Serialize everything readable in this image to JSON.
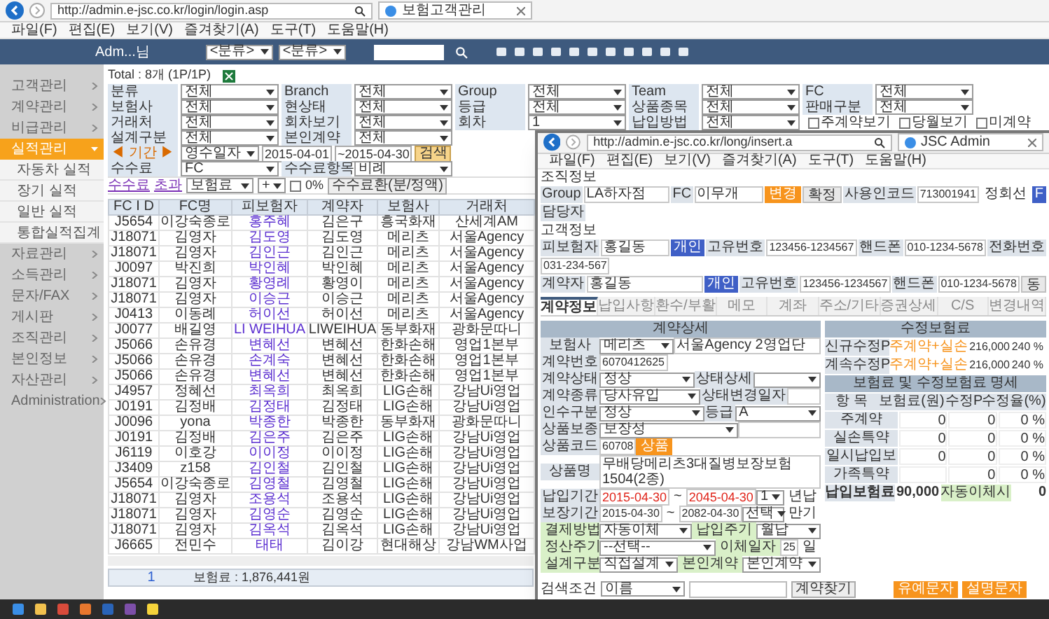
{
  "browser": {
    "url": "http://admin.e-jsc.co.kr/login/login.asp",
    "tab": "보험고객관리",
    "menu": [
      "파일(F)",
      "편집(E)",
      "보기(V)",
      "즐겨찾기(A)",
      "도구(T)",
      "도움말(H)"
    ]
  },
  "app_header": {
    "user": "Adm...님",
    "selects": [
      "<분류>",
      "<분류>"
    ]
  },
  "sidebar": [
    {
      "label": "고객관리",
      "kind": "menu",
      "selected": false
    },
    {
      "label": "계약관리",
      "kind": "menu",
      "selected": false
    },
    {
      "label": "비급관리",
      "kind": "menu",
      "selected": false
    },
    {
      "label": "실적관리",
      "kind": "menu",
      "selected": true
    },
    {
      "label": "자동차 실적",
      "kind": "sub",
      "selected": false
    },
    {
      "label": "장기 실적",
      "kind": "sub",
      "selected": false
    },
    {
      "label": "일반 실적",
      "kind": "sub",
      "selected": false
    },
    {
      "label": "통합실적집계",
      "kind": "sub",
      "selected": false
    },
    {
      "label": "자료관리",
      "kind": "menu",
      "selected": false
    },
    {
      "label": "소득관리",
      "kind": "menu",
      "selected": false
    },
    {
      "label": "문자/FAX",
      "kind": "menu",
      "selected": false
    },
    {
      "label": "게시판",
      "kind": "menu",
      "selected": false
    },
    {
      "label": "조직관리",
      "kind": "menu",
      "selected": false
    },
    {
      "label": "본인정보",
      "kind": "menu",
      "selected": false
    },
    {
      "label": "자산관리",
      "kind": "menu",
      "selected": false
    },
    {
      "label": "Administration",
      "kind": "menu",
      "selected": false
    }
  ],
  "total": "Total : 8개 (1P/1P)",
  "filter_rows": [
    [
      {
        "label": "분류",
        "value": "전체"
      },
      {
        "label": "Branch",
        "value": "전체"
      },
      {
        "label": "Group",
        "value": "전체"
      },
      {
        "label": "Team",
        "value": "전체"
      },
      {
        "label": "FC",
        "value": "전체"
      }
    ],
    [
      {
        "label": "보험사",
        "value": "전체"
      },
      {
        "label": "현상태",
        "value": "전체"
      },
      {
        "label": "등급",
        "value": "전체"
      },
      {
        "label": "상품종목",
        "value": "전체"
      },
      {
        "label": "판매구분",
        "value": "전체"
      }
    ],
    [
      {
        "label": "거래처",
        "value": "전체"
      },
      {
        "label": "회차보기",
        "value": "전체"
      },
      {
        "label": "회차",
        "value": "1"
      },
      {
        "label": "납입방법",
        "value": "전체"
      }
    ]
  ],
  "filter_checks": [
    {
      "label": "주계약보기",
      "checked": false
    },
    {
      "label": "당월보기",
      "checked": false
    },
    {
      "label": "미계약",
      "checked": false
    }
  ],
  "filter_rows_left": [
    [
      {
        "label": "설계구분",
        "value": "전체"
      },
      {
        "label": "본인계약",
        "value": "전체"
      }
    ]
  ],
  "period": {
    "label": "◀ 기간 ▶",
    "select": "영수일자",
    "from": "2015-04-01",
    "to": "~2015-04-30",
    "button": "검색"
  },
  "fee_row": [
    {
      "label": "수수료",
      "value": "FC"
    },
    {
      "label": "수수료항목",
      "value": "비례"
    }
  ],
  "fee_toolbar": {
    "links": [
      "수수료",
      "초과"
    ],
    "select": "보험료",
    "select2": "+",
    "percent": "0%",
    "checked": false,
    "button": "수수료환(분/정액)"
  },
  "table": {
    "columns": [
      "FC I D",
      "FC명",
      "피보험자",
      "계약자",
      "보험사",
      "거래처"
    ],
    "rows": [
      [
        "J5654",
        "이강숙종로",
        "홍주혜",
        "김은구",
        "흥국화재",
        "산세계AM"
      ],
      [
        "J18071",
        "김영자",
        "김도영",
        "김도영",
        "메리츠",
        "서울Agency"
      ],
      [
        "J18071",
        "김영자",
        "김인근",
        "김인근",
        "메리츠",
        "서울Agency"
      ],
      [
        "J0097",
        "박진희",
        "박인혜",
        "박인혜",
        "메리츠",
        "서울Agency"
      ],
      [
        "J18071",
        "김영자",
        "황영례",
        "황영이",
        "메리츠",
        "서울Agency"
      ],
      [
        "J18071",
        "김영자",
        "이승근",
        "이승근",
        "메리츠",
        "서울Agency"
      ],
      [
        "J0413",
        "이동례",
        "허이선",
        "허이선",
        "메리츠",
        "서울Agency"
      ],
      [
        "J0077",
        "배길영",
        "LI WEIHUA",
        "LIWEIHUA",
        "동부화재",
        "광화문따니"
      ],
      [
        "J5066",
        "손유경",
        "변혜선",
        "변혜선",
        "한화손해",
        "영업1본부"
      ],
      [
        "J5066",
        "손유경",
        "손계숙",
        "변혜선",
        "한화손해",
        "영업1본부"
      ],
      [
        "J5066",
        "손유경",
        "변혜선",
        "변혜선",
        "한화손해",
        "영업1본부"
      ],
      [
        "J4957",
        "정혜선",
        "최옥희",
        "최옥희",
        "LIG손해",
        "강남Ui영업"
      ],
      [
        "J0191",
        "김정배",
        "김정태",
        "김정태",
        "LIG손해",
        "강남Ui영업"
      ],
      [
        "J0096",
        "yona",
        "박종한",
        "박종한",
        "동부화재",
        "광화문따니"
      ],
      [
        "J0191",
        "김정배",
        "김은주",
        "김은주",
        "LIG손해",
        "강남Ui영업"
      ],
      [
        "J6119",
        "이호강",
        "이이정",
        "이이정",
        "LIG손해",
        "강남Ui영업"
      ],
      [
        "J3409",
        "z158",
        "김인철",
        "김인철",
        "LIG손해",
        "강남Ui영업"
      ],
      [
        "J5654",
        "이강숙종로",
        "김영철",
        "김영철",
        "LIG손해",
        "강남Ui영업"
      ],
      [
        "J18071",
        "김영자",
        "조용석",
        "조용석",
        "LIG손해",
        "강남Ui영업"
      ],
      [
        "J18071",
        "김영자",
        "김영순",
        "김영순",
        "LIG손해",
        "강남Ui영업"
      ],
      [
        "J18071",
        "김영자",
        "김옥석",
        "김옥석",
        "LIG손해",
        "강남Ui영업"
      ],
      [
        "J6665",
        "전민수",
        "태태",
        "김이강",
        "현대해상",
        "강남WM사업"
      ]
    ]
  },
  "pager": {
    "page": "1",
    "summary": "보험료 : 1,876,441원"
  },
  "popup": {
    "url": "http://admin.e-jsc.co.kr/long/insert.a",
    "tab": "JSC Admin",
    "menu": [
      "파일(F)",
      "편집(E)",
      "보기(V)",
      "즐겨찾기(A)",
      "도구(T)",
      "도움말(H)"
    ],
    "org": {
      "title": "조직정보",
      "items": [
        {
          "kind": "label",
          "text": "Group"
        },
        {
          "kind": "field",
          "text": "LA하자점"
        },
        {
          "kind": "label",
          "text": "FC"
        },
        {
          "kind": "field",
          "text": "이무개"
        },
        {
          "kind": "accent",
          "text": "변경"
        },
        {
          "kind": "button",
          "text": "확정"
        },
        {
          "kind": "label",
          "text": "사용인코드"
        },
        {
          "kind": "number",
          "text": "713001941"
        },
        {
          "kind": "text",
          "text": "정회선"
        },
        {
          "kind": "badge",
          "text": "F"
        },
        {
          "kind": "label",
          "text": "담당자"
        }
      ]
    },
    "customer": {
      "title": "고객정보",
      "rows": [
        {
          "items": [
            {
              "kind": "label",
              "text": "피보험자"
            },
            {
              "kind": "field",
              "text": "홍길동"
            },
            {
              "kind": "badge",
              "text": "개인"
            },
            {
              "kind": "label",
              "text": "고유번호"
            },
            {
              "kind": "number",
              "text": "123456-1234567"
            },
            {
              "kind": "label",
              "text": "핸드폰"
            },
            {
              "kind": "number",
              "text": "010-1234-5678"
            },
            {
              "kind": "label",
              "text": "전화번호"
            },
            {
              "kind": "number",
              "text": "031-234-567"
            }
          ]
        },
        {
          "items": [
            {
              "kind": "label",
              "text": "계약자"
            },
            {
              "kind": "field",
              "text": "홍길동"
            },
            {
              "kind": "badge",
              "text": "개인"
            },
            {
              "kind": "label",
              "text": "고유번호"
            },
            {
              "kind": "number",
              "text": "123456-1234567"
            },
            {
              "kind": "label",
              "text": "핸드폰"
            },
            {
              "kind": "number",
              "text": "010-1234-5678"
            },
            {
              "kind": "button",
              "text": "동"
            }
          ]
        }
      ]
    },
    "tabs": [
      {
        "label": "계약정보",
        "selected": true
      },
      {
        "label": "납입사항",
        "selected": false
      },
      {
        "label": "환수/부활",
        "selected": false
      },
      {
        "label": "메모",
        "selected": false
      },
      {
        "label": "계좌",
        "selected": false
      },
      {
        "label": "주소/기타",
        "selected": false
      },
      {
        "label": "증권상세",
        "selected": false
      },
      {
        "label": "C/S",
        "selected": false
      },
      {
        "label": "변경내역",
        "selected": false
      }
    ],
    "contract": {
      "title": "계약상세",
      "rows": [
        {
          "items": [
            {
              "kind": "label",
              "text": "보험사"
            },
            {
              "kind": "select",
              "text": "메리츠"
            },
            {
              "kind": "field",
              "text": "서울Agency 2영업단"
            }
          ]
        },
        {
          "items": [
            {
              "kind": "label",
              "text": "계약번호"
            },
            {
              "kind": "number",
              "text": "6070412625"
            }
          ]
        },
        {
          "items": [
            {
              "kind": "label",
              "text": "계약상태"
            },
            {
              "kind": "select",
              "text": "정상"
            },
            {
              "kind": "label",
              "text": "상태상세"
            },
            {
              "kind": "select"
            }
          ]
        },
        {
          "items": [
            {
              "kind": "label",
              "text": "계약종류"
            },
            {
              "kind": "select",
              "text": "당사유입"
            },
            {
              "kind": "label",
              "text": "상태변경일자"
            },
            {
              "kind": "field"
            }
          ]
        },
        {
          "items": [
            {
              "kind": "label",
              "text": "인수구분"
            },
            {
              "kind": "select",
              "text": "정상"
            },
            {
              "kind": "label",
              "text": "등급"
            },
            {
              "kind": "select",
              "text": "A"
            }
          ]
        },
        {
          "items": [
            {
              "kind": "label",
              "text": "상품보종"
            },
            {
              "kind": "select",
              "text": "보장성"
            },
            {
              "kind": "field"
            }
          ]
        },
        {
          "items": [
            {
              "kind": "label",
              "text": "상품코드"
            },
            {
              "kind": "number",
              "text": "60708"
            },
            {
              "kind": "accent",
              "text": "상품"
            }
          ]
        },
        {
          "items": [
            {
              "kind": "label",
              "text": "상품명"
            },
            {
              "kind": "longfield",
              "text": "무배당메리츠3대질병보장보험1504(2종)"
            }
          ]
        },
        {
          "items": [
            {
              "kind": "label",
              "text": "납입기간"
            },
            {
              "kind": "date",
              "text": "2015-04-30"
            },
            {
              "kind": "text",
              "text": "~"
            },
            {
              "kind": "date",
              "text": "2045-04-30"
            },
            {
              "kind": "select",
              "text": "1"
            },
            {
              "kind": "text",
              "text": "년납"
            }
          ]
        },
        {
          "items": [
            {
              "kind": "label",
              "text": "보장기간"
            },
            {
              "kind": "number",
              "text": "2015-04-30"
            },
            {
              "kind": "text",
              "text": "~"
            },
            {
              "kind": "number",
              "text": "2082-04-30"
            },
            {
              "kind": "select",
              "text": "선택"
            },
            {
              "kind": "text",
              "text": "만기"
            }
          ]
        },
        {
          "items": [
            {
              "kind": "green",
              "text": "결제방법"
            },
            {
              "kind": "select",
              "text": "자동이체"
            },
            {
              "kind": "green",
              "text": "납입주기"
            },
            {
              "kind": "select",
              "text": "월납"
            }
          ]
        },
        {
          "items": [
            {
              "kind": "green",
              "text": "정산주기"
            },
            {
              "kind": "select",
              "text": "--선택--"
            },
            {
              "kind": "green",
              "text": "이체일자"
            },
            {
              "kind": "number",
              "text": "25"
            },
            {
              "kind": "text",
              "text": "일"
            }
          ]
        },
        {
          "items": [
            {
              "kind": "green",
              "text": "설계구분"
            },
            {
              "kind": "select",
              "text": "직접설계"
            },
            {
              "kind": "green",
              "text": "본인계약"
            },
            {
              "kind": "select",
              "text": "본인계약"
            }
          ]
        }
      ]
    },
    "premium": {
      "title": "수정보험료",
      "rows": [
        [
          "신규수정P",
          "주계약+실손",
          "216,000",
          "240 %"
        ],
        [
          "계속수정P",
          "주계약+실손",
          "216,000",
          "240 %"
        ]
      ],
      "detail_title": "보험료 및 수정보험료 명세",
      "detail_columns": [
        "항 목",
        "보험료(원)",
        "수정P",
        "수정율(%)"
      ],
      "detail_rows": [
        [
          "주계약",
          "0",
          "0",
          "0 %"
        ],
        [
          "실손특약",
          "0",
          "0",
          "0 %"
        ],
        [
          "일시납입보",
          "0",
          "0",
          "0 %"
        ],
        [
          "가족특약",
          "",
          "0",
          "0 %"
        ]
      ],
      "total": [
        "납입보험료",
        "90,000",
        "자동이체시",
        "0"
      ]
    },
    "search": {
      "label": "검색조건",
      "select": "이름",
      "button": "계약찾기",
      "actions": [
        "유예문자",
        "설명문자"
      ]
    }
  }
}
